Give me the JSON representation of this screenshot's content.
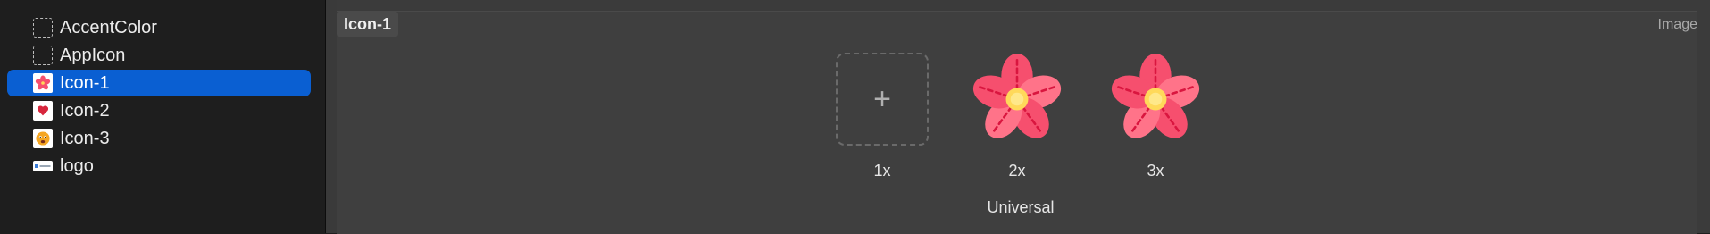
{
  "sidebar": {
    "items": [
      {
        "label": "AccentColor",
        "icon": "dashed-square-icon"
      },
      {
        "label": "AppIcon",
        "icon": "dashed-square-icon"
      },
      {
        "label": "Icon-1",
        "icon": "flower-thumbnail",
        "selected": true
      },
      {
        "label": "Icon-2",
        "icon": "heart-thumbnail"
      },
      {
        "label": "Icon-3",
        "icon": "face-thumbnail"
      },
      {
        "label": "logo",
        "icon": "logo-thumbnail"
      }
    ]
  },
  "editor": {
    "asset_name": "Icon-1",
    "type_label": "Image",
    "slots": [
      {
        "scale": "1x",
        "empty": true
      },
      {
        "scale": "2x",
        "empty": false
      },
      {
        "scale": "3x",
        "empty": false
      }
    ],
    "group_label": "Universal"
  },
  "colors": {
    "selection": "#0a5fd2",
    "petal": "#f64f6e",
    "petal_light": "#ff7389",
    "center": "#ffd95a"
  }
}
